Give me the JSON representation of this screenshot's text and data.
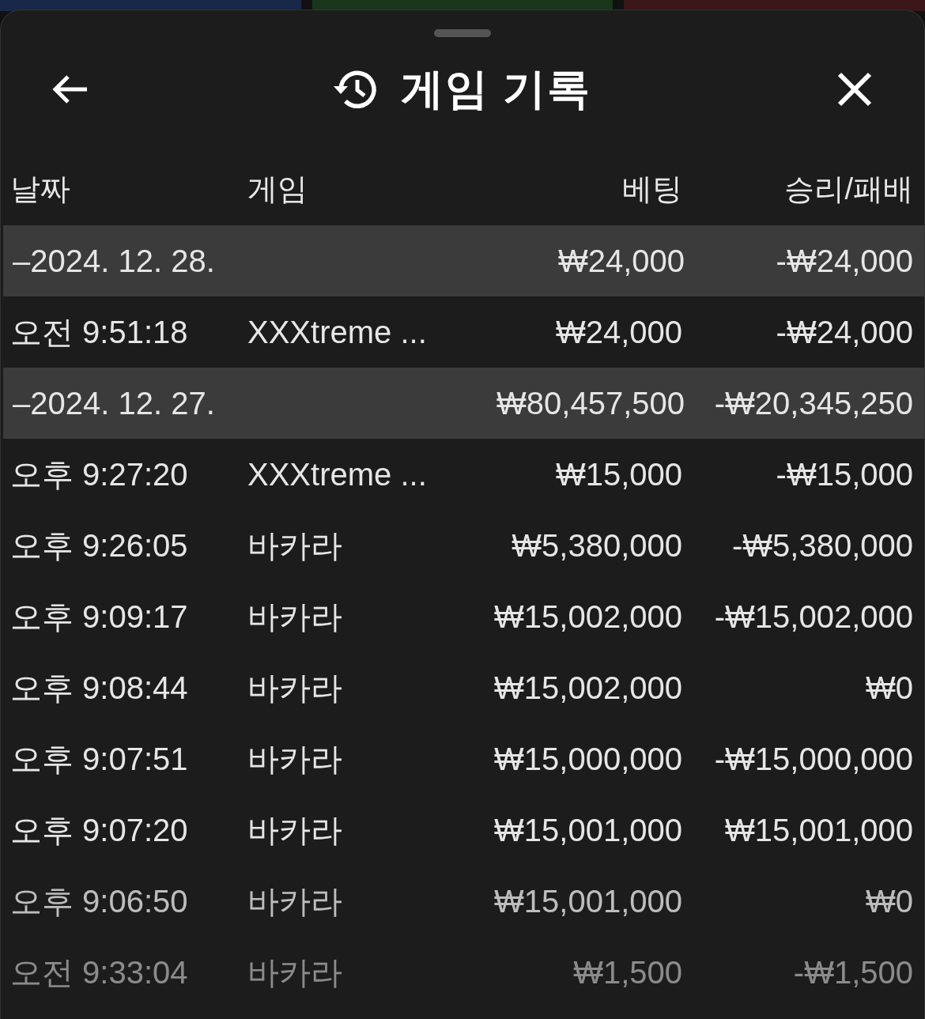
{
  "header": {
    "title": "게임 기록"
  },
  "columns": [
    "날짜",
    "게임",
    "베팅",
    "승리/패배"
  ],
  "groups": [
    {
      "date": "–2024. 12. 28.",
      "bet": "₩24,000",
      "result": "-₩24,000",
      "rows": [
        {
          "time": "오전 9:51:18",
          "game": "XXXtreme ...",
          "bet": "₩24,000",
          "result": "-₩24,000"
        }
      ]
    },
    {
      "date": "–2024. 12. 27.",
      "bet": "₩80,457,500",
      "result": "-₩20,345,250",
      "rows": [
        {
          "time": "오후 9:27:20",
          "game": "XXXtreme ...",
          "bet": "₩15,000",
          "result": "-₩15,000"
        },
        {
          "time": "오후 9:26:05",
          "game": "바카라",
          "bet": "₩5,380,000",
          "result": "-₩5,380,000"
        },
        {
          "time": "오후 9:09:17",
          "game": "바카라",
          "bet": "₩15,002,000",
          "result": "-₩15,002,000"
        },
        {
          "time": "오후 9:08:44",
          "game": "바카라",
          "bet": "₩15,002,000",
          "result": "₩0"
        },
        {
          "time": "오후 9:07:51",
          "game": "바카라",
          "bet": "₩15,000,000",
          "result": "-₩15,000,000"
        },
        {
          "time": "오후 9:07:20",
          "game": "바카라",
          "bet": "₩15,001,000",
          "result": "₩15,001,000"
        },
        {
          "time": "오후 9:06:50",
          "game": "바카라",
          "bet": "₩15,001,000",
          "result": "₩0"
        },
        {
          "time": "오전 9:33:04",
          "game": "바카라",
          "bet": "₩1,500",
          "result": "-₩1,500"
        }
      ]
    }
  ]
}
